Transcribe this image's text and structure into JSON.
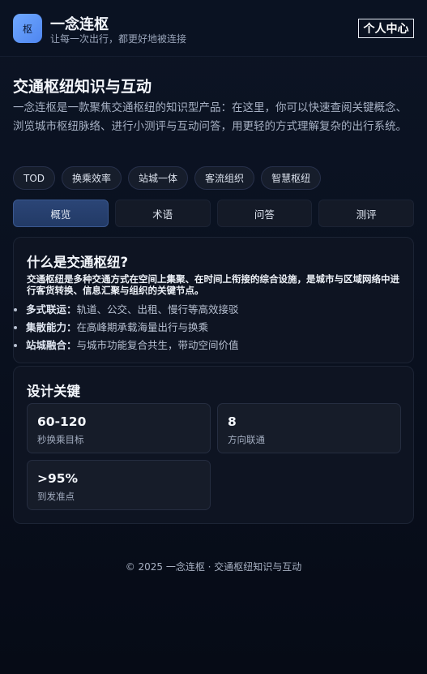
{
  "header": {
    "logo_char": "枢",
    "brand": "一念连枢",
    "tagline": "让每一次出行，都更好地被连接",
    "profile_label": "个人中心"
  },
  "hero": {
    "title": "交通枢纽知识与互动",
    "intro": "一念连枢是一款聚焦交通枢纽的知识型产品：在这里，你可以快速查阅关键概念、浏览城市枢纽脉络、进行小测评与互动问答，用更轻的方式理解复杂的出行系统。",
    "tags": [
      "TOD",
      "换乘效率",
      "站城一体",
      "客流组织",
      "智慧枢纽"
    ]
  },
  "tabs": [
    {
      "label": "概览",
      "active": true
    },
    {
      "label": "术语",
      "active": false
    },
    {
      "label": "问答",
      "active": false
    },
    {
      "label": "测评",
      "active": false
    }
  ],
  "overview": {
    "title": "什么是交通枢纽?",
    "lead": "交通枢纽是多种交通方式在空间上集聚、在时间上衔接的综合设施，是城市与区域网络中进行客货转换、信息汇聚与组织的关键节点。",
    "bullets": [
      {
        "key": "多式联运：",
        "text": "轨道、公交、出租、慢行等高效接驳"
      },
      {
        "key": "集散能力：",
        "text": "在高峰期承载海量出行与换乘"
      },
      {
        "key": "站城融合：",
        "text": "与城市功能复合共生，带动空间价值"
      }
    ]
  },
  "design": {
    "title": "设计关键",
    "stats": [
      {
        "value": "60-120",
        "label": "秒换乘目标"
      },
      {
        "value": "8",
        "label": "方向联通"
      },
      {
        "value": ">95%",
        "label": "到发准点"
      }
    ]
  },
  "footer": {
    "text": "© 2025 一念连枢 · 交通枢纽知识与互动"
  }
}
